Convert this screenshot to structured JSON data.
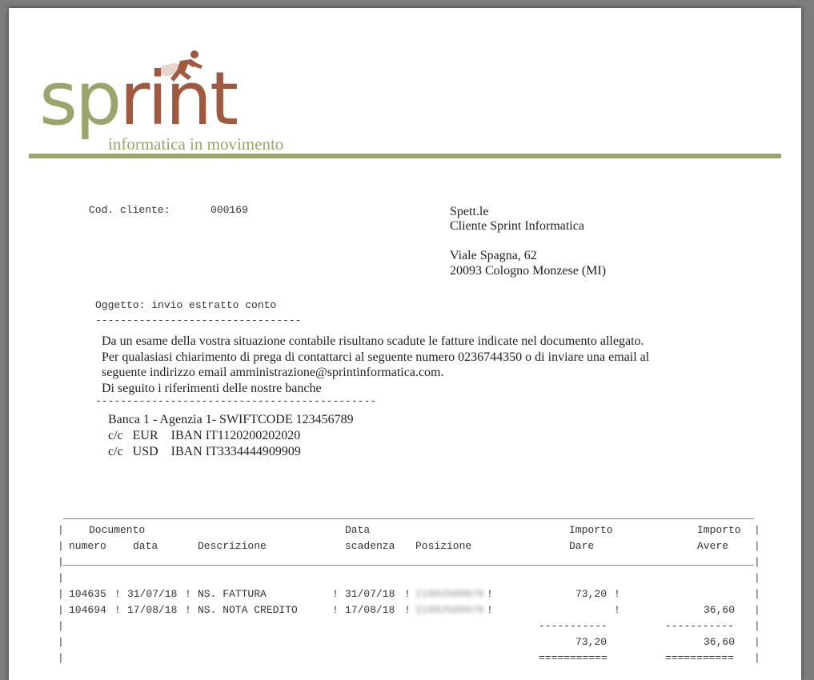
{
  "logo": {
    "word_sp": "sp",
    "word_rint": "rint",
    "tagline": "informatica in movimento",
    "green": "#9aa56b",
    "rust": "#a0583f"
  },
  "client": {
    "code_label": "Cod. cliente:",
    "code_value": "000169"
  },
  "address": {
    "salutation": "Spett.le",
    "name": "Cliente Sprint Informatica",
    "street": "Viale Spagna, 62",
    "city": "20093 Cologno Monzese (MI)"
  },
  "subject": {
    "text": "Oggetto: invio estratto conto",
    "underline": "---------------------------------"
  },
  "body": {
    "lines": [
      "Da un esame della vostra situazione contabile risultano scadute le fatture indicate nel documento allegato.",
      "Per qualasiasi chiarimento di prega di contattarci al seguente numero 0236744350 o di inviare una email al",
      "seguente indirizzo email amministrazione@sprintinformatica.com.",
      "Di seguito i riferimenti delle nostre banche"
    ],
    "separator": "---------------------------------------------"
  },
  "banks": {
    "lines": [
      "Banca 1 - Agenzia 1- SWIFTCODE 123456789",
      "c/c   EUR    IBAN IT1120200202020",
      "c/c   USD    IBAN IT3334444909909"
    ]
  },
  "table": {
    "headers": {
      "documento": "Documento",
      "numero": "numero",
      "data": "data",
      "descrizione": "Descrizione",
      "data2": "Data",
      "scadenza": "scadenza",
      "posizione": "Posizione",
      "importo_dare_1": "Importo",
      "importo_dare_2": "Dare",
      "importo_avere_1": "Importo",
      "importo_avere_2": "Avere"
    },
    "rows": [
      {
        "numero": "104635",
        "data": "31/07/18",
        "descrizione": "NS. FATTURA",
        "scadenza": "31/07/18",
        "posizione": "21802500076",
        "dare": "73,20",
        "avere": ""
      },
      {
        "numero": "104694",
        "data": "17/08/18",
        "descrizione": "NS. NOTA CREDITO",
        "scadenza": "17/08/18",
        "posizione": "21802500076",
        "dare": "",
        "avere": "36,60"
      }
    ],
    "subtotal_dashes": "-----------",
    "total_dare": "73,20",
    "total_avere": "36,60",
    "total_equals": "==========="
  }
}
